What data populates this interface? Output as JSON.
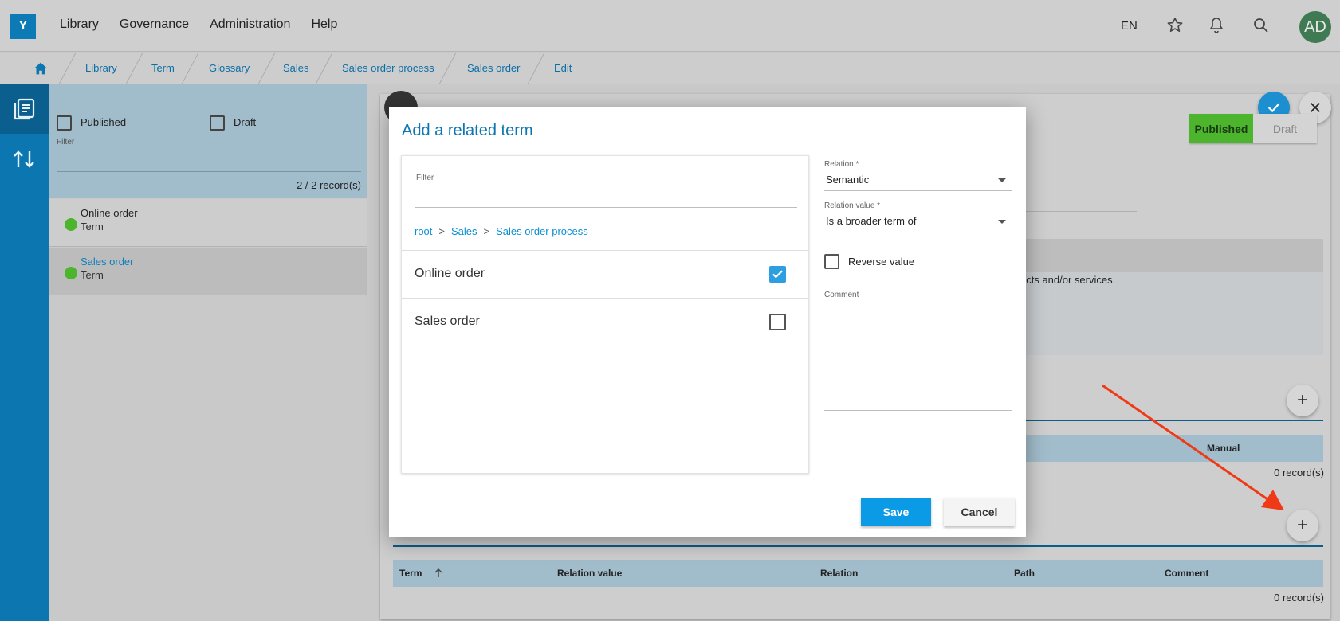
{
  "topbar": {
    "logo": "Y",
    "nav": [
      "Library",
      "Governance",
      "Administration",
      "Help"
    ],
    "language": "EN",
    "avatar_initials": "AD"
  },
  "breadcrumb": [
    "Library",
    "Term",
    "Glossary",
    "Sales",
    "Sales order process",
    "Sales order",
    "Edit"
  ],
  "list_panel": {
    "filter_published": "Published",
    "filter_draft": "Draft",
    "filter_label": "Filter",
    "records": "2 / 2 record(s)",
    "items": [
      {
        "name": "Online order",
        "type": "Term",
        "status_color": "#4cb52d"
      },
      {
        "name": "Sales order",
        "type": "Term",
        "status_color": "#4cb52d"
      }
    ]
  },
  "main": {
    "status_toggle": {
      "published": "Published",
      "draft": "Draft"
    },
    "description_fragment": "ucts and/or services",
    "table1": {
      "last_header": "Manual",
      "records": "0 record(s)"
    },
    "table2": {
      "headers": [
        "Term",
        "Relation value",
        "Relation",
        "Path",
        "Comment"
      ],
      "records": "0 record(s)"
    }
  },
  "modal": {
    "title": "Add a related term",
    "filter_label": "Filter",
    "path": [
      "root",
      "Sales",
      "Sales order process"
    ],
    "path_separator": ">",
    "options": [
      {
        "label": "Online order",
        "checked": true
      },
      {
        "label": "Sales order",
        "checked": false
      }
    ],
    "relation_label": "Relation *",
    "relation_value": "Semantic",
    "relation_value_label": "Relation value *",
    "relation_value_value": "Is a broader term of",
    "reverse_label": "Reverse value",
    "comment_label": "Comment",
    "save": "Save",
    "cancel": "Cancel"
  },
  "colors": {
    "accent": "#0b76b0",
    "published_green": "#4cb52d",
    "save_button": "#0b9ae6",
    "annotation_arrow": "#f03a17"
  }
}
